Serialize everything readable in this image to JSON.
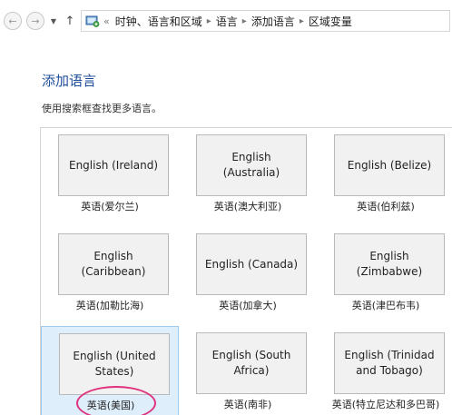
{
  "breadcrumbs": [
    "时钟、语言和区域",
    "语言",
    "添加语言",
    "区域变量"
  ],
  "overflow_glyph": "«",
  "page_title": "添加语言",
  "instructions": "使用搜索框查找更多语言。",
  "languages": [
    {
      "name": "English (Ireland)",
      "label": "英语(爱尔兰)"
    },
    {
      "name": "English (Australia)",
      "label": "英语(澳大利亚)"
    },
    {
      "name": "English (Belize)",
      "label": "英语(伯利兹)"
    },
    {
      "name": "English (Caribbean)",
      "label": "英语(加勒比海)"
    },
    {
      "name": "English (Canada)",
      "label": "英语(加拿大)"
    },
    {
      "name": "English (Zimbabwe)",
      "label": "英语(津巴布韦)"
    },
    {
      "name": "English (United States)",
      "label": "英语(美国)",
      "selected": true
    },
    {
      "name": "English (South Africa)",
      "label": "英语(南非)"
    },
    {
      "name": "English (Trinidad and Tobago)",
      "label": "英语(特立尼达和多巴哥)"
    }
  ],
  "colors": {
    "title": "#1f4e9b",
    "selection": "#dfeefb",
    "highlight_ring": "#e0337d"
  }
}
